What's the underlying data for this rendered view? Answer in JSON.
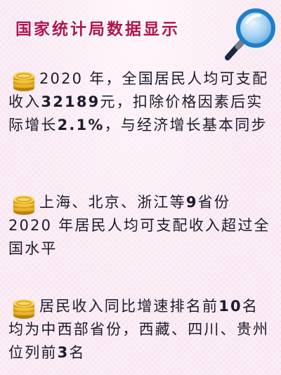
{
  "header": {
    "title": "国家统计局数据显示"
  },
  "items": [
    {
      "p1": "2020 年，全国居民人均可支配收入",
      "n1": "32189",
      "p2": "元，扣除价格因素后实际增长",
      "n2": "2.1%",
      "p3": "，与经济增长基本同步"
    },
    {
      "p1": "上海、北京、浙江等",
      "n1": "9",
      "p2": "省份 2020 年居民人均可支配收入超过全国水平"
    },
    {
      "p1": "居民收入同比增速排名前",
      "n1": "10",
      "p2": "名均为中西部省份，西藏、四川、贵州位列前",
      "n2": "3",
      "p3": "名"
    }
  ],
  "colors": {
    "title": "#b3124f",
    "background": "#fbeef6",
    "coin": "#e8b32a",
    "lens_border": "#1e7fc8",
    "handle": "#1a2940"
  },
  "icons": {
    "coin": "coin-stack-icon",
    "magnifier": "magnifier-icon"
  }
}
